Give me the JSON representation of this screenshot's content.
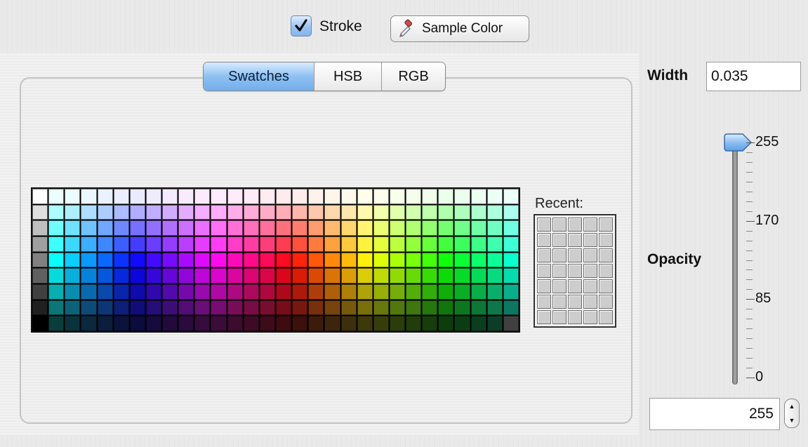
{
  "stroke": {
    "label": "Stroke",
    "checked": true
  },
  "sample_button": {
    "label": "Sample Color",
    "icon": "eyedropper-icon"
  },
  "tabs": [
    {
      "label": "Swatches",
      "active": true
    },
    {
      "label": "HSB",
      "active": false
    },
    {
      "label": "RGB",
      "active": false
    }
  ],
  "recent": {
    "label": "Recent:",
    "slots": 35,
    "slot_color": "#cdcdcd"
  },
  "width": {
    "label": "Width",
    "value": "0.035"
  },
  "opacity": {
    "label": "Opacity",
    "value": "255",
    "slider_level": 1.0,
    "ticks": [
      "255",
      "170",
      "85",
      "0"
    ]
  },
  "colors": {
    "accent": "#86b4ec",
    "grid_border": "#111111"
  }
}
